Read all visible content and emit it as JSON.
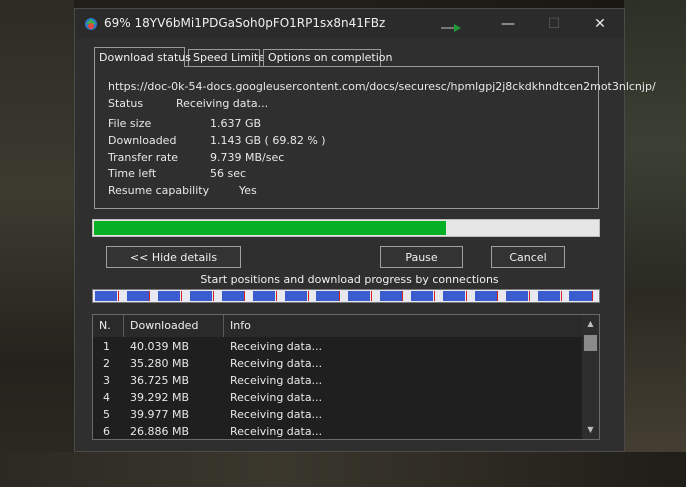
{
  "window": {
    "title": "69% 18YV6bMi1PDGaSoh0pFO1RP1sx8n41FBz",
    "minimize": "—",
    "maximize": "☐",
    "close": "✕"
  },
  "tabs": [
    {
      "label": "Download status",
      "active": true
    },
    {
      "label": "Speed Limiter",
      "active": false
    },
    {
      "label": "Options on completion",
      "active": false
    }
  ],
  "status": {
    "url": "https://doc-0k-54-docs.googleusercontent.com/docs/securesc/hpmlgpj2j8ckdkhndtcen2mot3nlcnjp/",
    "status_label": "Status",
    "status_value": "Receiving data...",
    "file_size_label": "File size",
    "file_size_value": "1.637  GB",
    "downloaded_label": "Downloaded",
    "downloaded_value": "1.143  GB  ( 69.82 % )",
    "transfer_rate_label": "Transfer rate",
    "transfer_rate_value": "9.739  MB/sec",
    "time_left_label": "Time left",
    "time_left_value": "56 sec",
    "resume_label": "Resume capability",
    "resume_value": "Yes"
  },
  "progress": {
    "fraction": 0.6982,
    "color": "#06b025"
  },
  "buttons": {
    "hide_details": "<< Hide details",
    "pause": "Pause",
    "cancel": "Cancel"
  },
  "connections_label": "Start positions and download progress by connections",
  "connection_segments": 16,
  "list": {
    "headers": [
      "N.",
      "Downloaded",
      "Info"
    ],
    "rows": [
      [
        "1",
        "40.039  MB",
        "Receiving data..."
      ],
      [
        "2",
        "35.280  MB",
        "Receiving data..."
      ],
      [
        "3",
        "36.725  MB",
        "Receiving data..."
      ],
      [
        "4",
        "39.292  MB",
        "Receiving data..."
      ],
      [
        "5",
        "39.977  MB",
        "Receiving data..."
      ],
      [
        "6",
        "26.886  MB",
        "Receiving data..."
      ]
    ]
  }
}
